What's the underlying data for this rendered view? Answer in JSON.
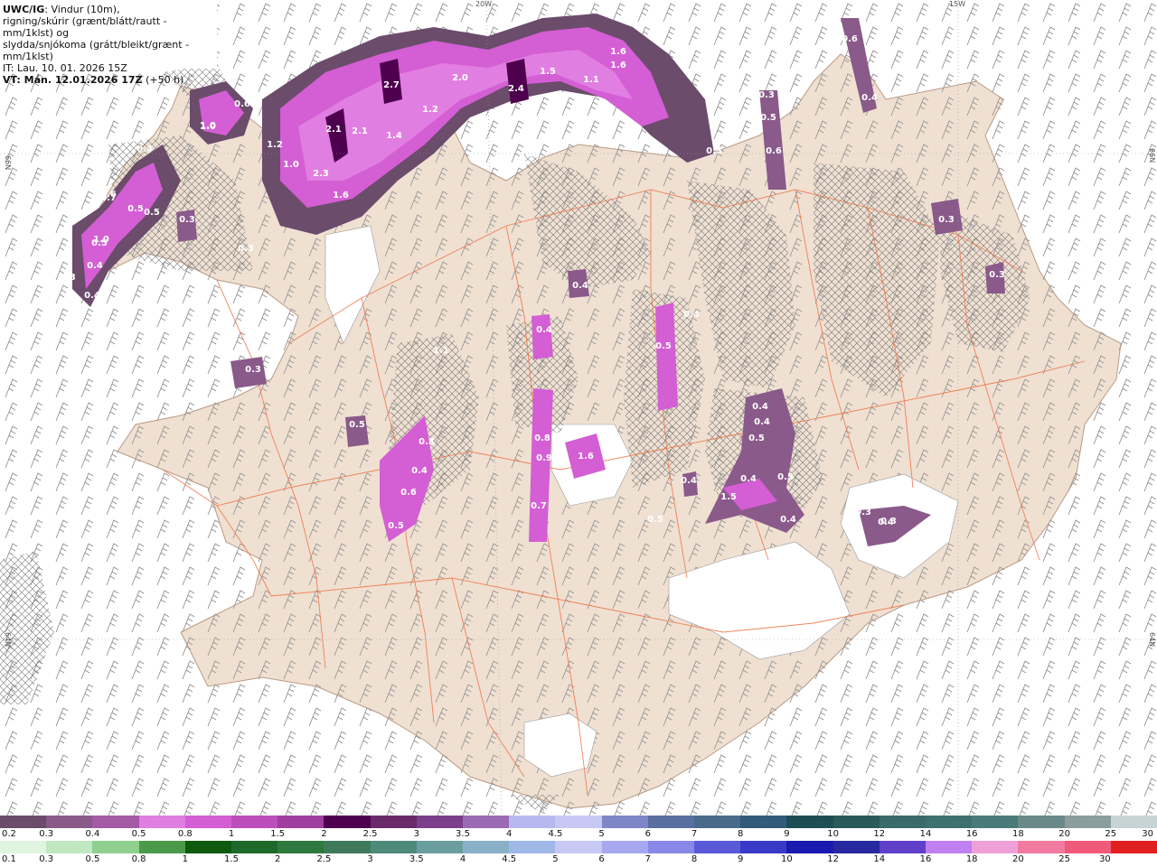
{
  "header": {
    "model": "UWC/IG",
    "title_rest": ": Vindur (10m),",
    "line2": "rigning/skúrir (grænt/blátt/rautt - mm/1klst) og",
    "line3": "slydda/snjókoma (grátt/bleikt/grænt - mm/1klst)",
    "init_time": "IT: Lau. 10. 01. 2026 15Z",
    "valid_time": "VT: Mán. 12.01.2026 17Z",
    "lead": "(+50 h)"
  },
  "graticule": [
    "20W",
    "15W",
    "66N",
    "66N",
    "64N",
    "64N"
  ],
  "precip_labels": [
    "1.0",
    "0.6",
    "1.0",
    "0.6",
    "0.4",
    "0.7",
    "0.5",
    "0.5",
    "0.3",
    "0.3",
    "0.5",
    "0.3",
    "0.4",
    "0.4",
    "1.0",
    "1.2",
    "1.0",
    "2.1",
    "2.3",
    "1.6",
    "2.1",
    "1.4",
    "2.7",
    "1.2",
    "2.0",
    "2.4",
    "1.5",
    "1.1",
    "1.6",
    "1.6",
    "0.6",
    "0.3",
    "0.3",
    "0.5",
    "0.6",
    "0.4",
    "0.3",
    "0.4",
    "0.4",
    "0.4",
    "0.5",
    "1.1",
    "0.3",
    "0.5",
    "0.3",
    "0.4",
    "0.6",
    "0.5",
    "0.8",
    "0.9",
    "0.7",
    "1.6",
    "0.4",
    "0.5",
    "0.4",
    "0.4",
    "0.5",
    "0.5",
    "0.4",
    "1.5",
    "0.4",
    "0.3",
    "0.3",
    "0.4",
    "0.3"
  ],
  "legend_snow": {
    "labels": [
      "0.2",
      "0.3",
      "0.4",
      "0.5",
      "0.8",
      "1",
      "1.5",
      "2",
      "2.5",
      "3",
      "3.5",
      "4",
      "4.5",
      "5",
      "6",
      "7",
      "8",
      "9",
      "10",
      "12",
      "14",
      "16",
      "18",
      "20",
      "25",
      "30"
    ],
    "colors": [
      "#6b4c6b",
      "#8a5a8a",
      "#a45aa4",
      "#e17ee1",
      "#d45ed4",
      "#bb4ebb",
      "#a03ea0",
      "#4e004e",
      "#6a2a6a",
      "#7a3e8a",
      "#9a6ab5",
      "#b8b8f0",
      "#c8c8f5",
      "#7e86c8",
      "#5a6ea0",
      "#4a6a8a",
      "#335a7a",
      "#1e4e55",
      "#2a5a5a",
      "#3a6a6a",
      "#3e7070",
      "#4a7a7a",
      "#6a8a8a",
      "#8a9e9e",
      "#c8d4d4"
    ]
  },
  "legend_rain": {
    "labels": [
      "0.1",
      "0.3",
      "0.5",
      "0.8",
      "1",
      "1.5",
      "2",
      "2.5",
      "3",
      "3.5",
      "4",
      "4.5",
      "5",
      "6",
      "7",
      "8",
      "9",
      "10",
      "12",
      "14",
      "16",
      "18",
      "20",
      "25",
      "30"
    ],
    "colors": [
      "#e0f5e0",
      "#c0e8c0",
      "#8fd08f",
      "#4a9a4a",
      "#0e5a0e",
      "#1e6a2a",
      "#2e7a3e",
      "#3e7a5a",
      "#4e8a7a",
      "#6a9e9e",
      "#8ab0c8",
      "#a0b8e8",
      "#c8c8f5",
      "#a8a8f0",
      "#8888e8",
      "#5a5ad8",
      "#3a3ac8",
      "#1a1ab0",
      "#2828a0",
      "#6040c8",
      "#c080f0",
      "#f0a0d8",
      "#f07aa0",
      "#f05a7a",
      "#e02020"
    ]
  }
}
